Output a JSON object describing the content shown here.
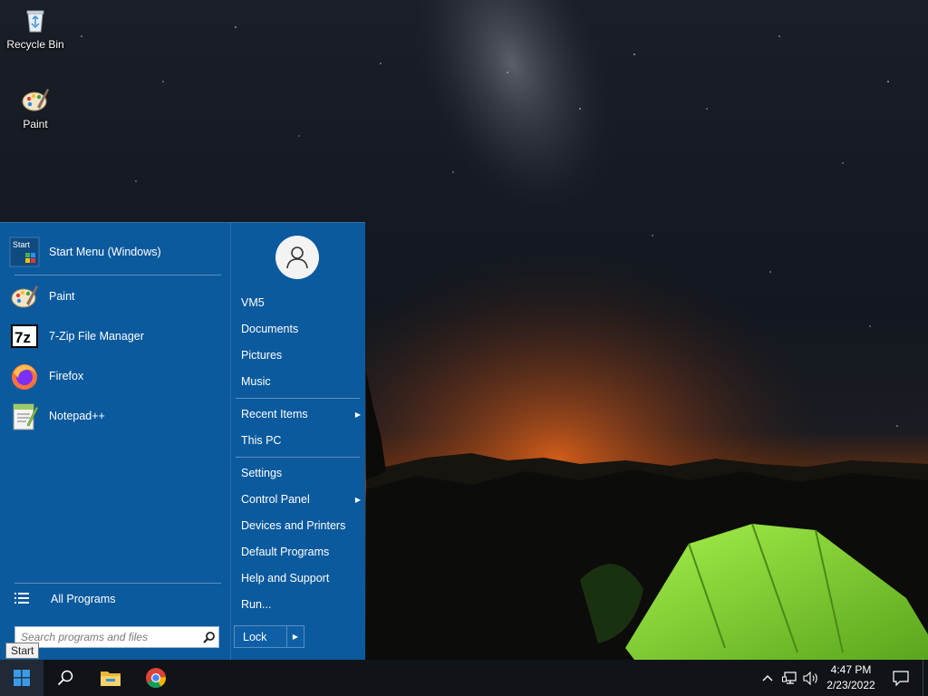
{
  "desktop": {
    "icons": [
      {
        "label": "Recycle Bin",
        "icon": "recycle-bin-icon"
      },
      {
        "label": "Paint",
        "icon": "paint-icon"
      }
    ]
  },
  "start_menu": {
    "pinned": {
      "label": "Start Menu (Windows)",
      "icon": "start-menu-settings-icon",
      "icon_text": "Start"
    },
    "programs": [
      {
        "label": "Paint",
        "icon": "paint-icon"
      },
      {
        "label": "7-Zip File Manager",
        "icon": "7zip-icon",
        "icon_text": "7z"
      },
      {
        "label": "Firefox",
        "icon": "firefox-icon"
      },
      {
        "label": "Notepad++",
        "icon": "notepad-plus-plus-icon"
      }
    ],
    "all_programs_label": "All Programs",
    "search_placeholder": "Search programs and files",
    "right_items": [
      {
        "label": "VM5",
        "submenu": false
      },
      {
        "label": "Documents",
        "submenu": false
      },
      {
        "label": "Pictures",
        "submenu": false
      },
      {
        "label": "Music",
        "submenu": false
      },
      {
        "label": "Recent Items",
        "submenu": true
      },
      {
        "label": "This PC",
        "submenu": false
      },
      {
        "label": "Settings",
        "submenu": false
      },
      {
        "label": "Control Panel",
        "submenu": true
      },
      {
        "label": "Devices and Printers",
        "submenu": false
      },
      {
        "label": "Default Programs",
        "submenu": false
      },
      {
        "label": "Help and Support",
        "submenu": false
      },
      {
        "label": "Run...",
        "submenu": false
      }
    ],
    "lock_label": "Lock",
    "arrow_glyph": "▶"
  },
  "tooltip": {
    "text": "Start"
  },
  "taskbar": {
    "pinned": [
      "search-icon",
      "file-explorer-icon",
      "chrome-icon"
    ],
    "tray_icons": [
      "chevron-up-icon",
      "network-icon",
      "volume-icon"
    ],
    "clock": {
      "time": "4:47 PM",
      "date": "2/23/2022"
    }
  },
  "colors": {
    "start_menu_bg": "#0b5a9e",
    "taskbar_bg": "#101418",
    "tent_green": "#8ee03a"
  }
}
